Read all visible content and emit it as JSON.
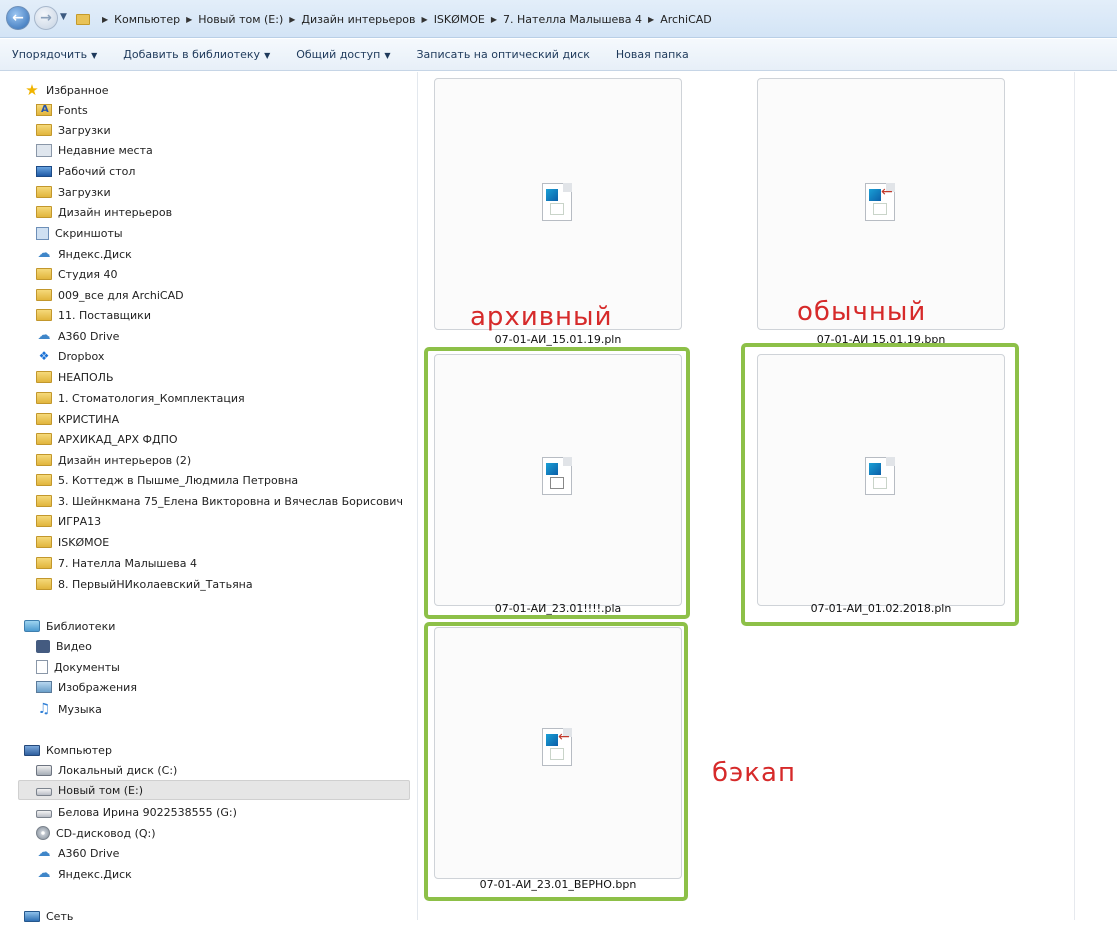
{
  "address_bar": {
    "breadcrumbs": [
      "Компьютер",
      "Новый том (E:)",
      "Дизайн интерьеров",
      "ISKØMOE",
      "7. Нателла Малышева 4",
      "ArchiCAD"
    ]
  },
  "toolbar": {
    "organize": "Упорядочить",
    "add_to_library": "Добавить в библиотеку",
    "share": "Общий доступ",
    "burn": "Записать на оптический диск",
    "new_folder": "Новая папка"
  },
  "nav": {
    "favorites_header": "Избранное",
    "favorites": [
      "Fonts",
      "Загрузки",
      "Недавние места",
      "Рабочий стол",
      "Загрузки",
      "Дизайн интерьеров",
      "Скриншоты",
      "Яндекс.Диск",
      "Студия 40",
      "009_все для ArchiCAD",
      "11. Поставщики",
      "A360 Drive",
      "Dropbox",
      "НЕАПОЛЬ",
      "1. Стоматология_Комплектация",
      "КРИСТИНА",
      "АРХИКАД_АРХ ФДПО",
      "Дизайн интерьеров (2)",
      "5. Коттедж в Пышме_Людмила Петровна",
      "3. Шейнкмана 75_Елена Викторовна и Вячеслав Борисович",
      "ИГРА13",
      "ISKØMOE",
      "7. Нателла Малышева 4",
      "8. ПервыйНИколаевский_Татьяна"
    ],
    "libraries_header": "Библиотеки",
    "libraries": [
      "Видео",
      "Документы",
      "Изображения",
      "Музыка"
    ],
    "computer_header": "Компьютер",
    "computer": [
      "Локальный диск (C:)",
      "Новый том (E:)",
      "Белова Ирина 9022538555 (G:)",
      "CD-дисковод (Q:)",
      "A360 Drive",
      "Яндекс.Диск"
    ],
    "network_header": "Сеть"
  },
  "files": [
    {
      "name": "07-01-АИ_15.01.19.pln",
      "icon": "archicad-archive-file-icon"
    },
    {
      "name": "07-01-АИ 15.01.19.bpn",
      "icon": "archicad-backup-file-icon"
    },
    {
      "name": "07-01-АИ_23.01!!!!.pla",
      "icon": "archicad-archive-file-icon"
    },
    {
      "name": "07-01-АИ_01.02.2018.pln",
      "icon": "archicad-plan-file-icon"
    },
    {
      "name": "07-01-АИ_23.01_ВЕРНО.bpn",
      "icon": "archicad-backup-file-icon"
    }
  ],
  "annotations": {
    "archive": "архивный",
    "normal": "обычный",
    "backup": "бэкап",
    "color": "#d62a2a",
    "frame_color": "#8dc048"
  }
}
